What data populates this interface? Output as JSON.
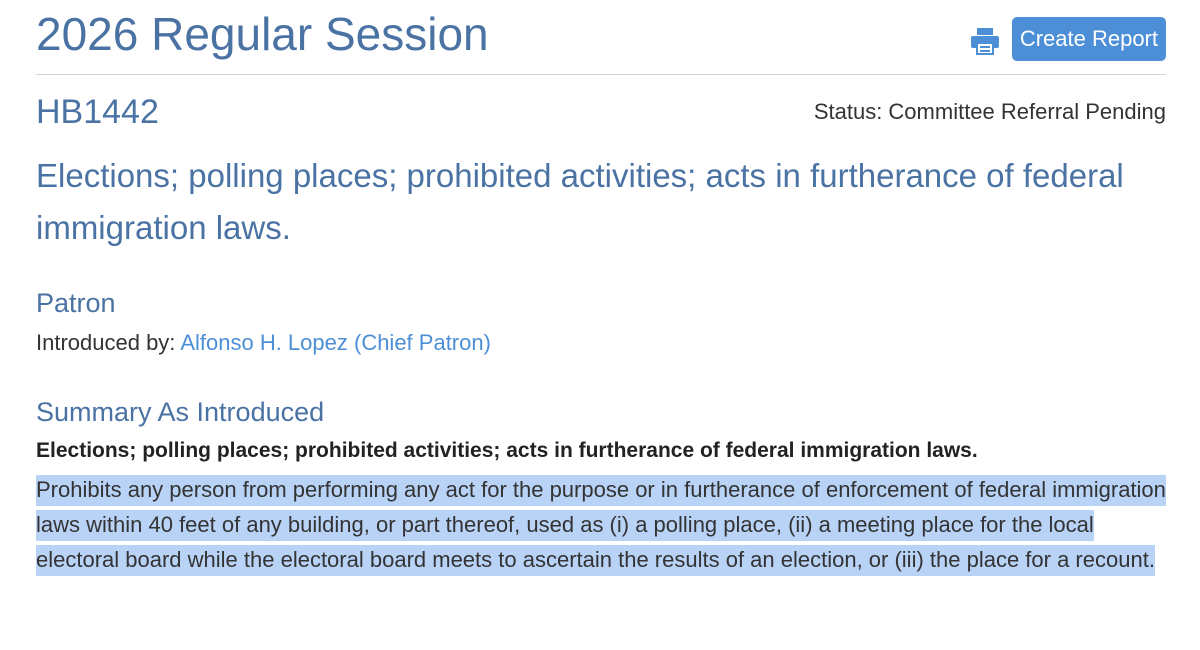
{
  "session": {
    "title": "2026 Regular Session"
  },
  "actions": {
    "print_icon": "printer-icon",
    "create_report_label": "Create Report"
  },
  "bill": {
    "number": "HB1442",
    "status": "Status: Committee Referral Pending",
    "caption": "Elections; polling places; prohibited activities; acts in furtherance of federal immigration laws."
  },
  "patron": {
    "heading": "Patron",
    "introduced_by_label": "Introduced by:",
    "patron_name": "Alfonso H. Lopez (Chief Patron)"
  },
  "summary": {
    "heading": "Summary As Introduced",
    "title": "Elections; polling places; prohibited activities; acts in furtherance of federal immigration laws.",
    "body": "Prohibits any person from performing any act for the purpose or in furtherance of enforcement of federal immigration laws within 40 feet of any building, or part thereof, used as (i) a polling place, (ii) a meeting place for the local electoral board while the electoral board meets to ascertain the results of an election, or (iii) the place for a recount.",
    "highlight_color": "#b9d3f7"
  },
  "colors": {
    "heading_blue": "#4a73a4",
    "link_blue": "#4d8fd6",
    "text": "#333333"
  }
}
